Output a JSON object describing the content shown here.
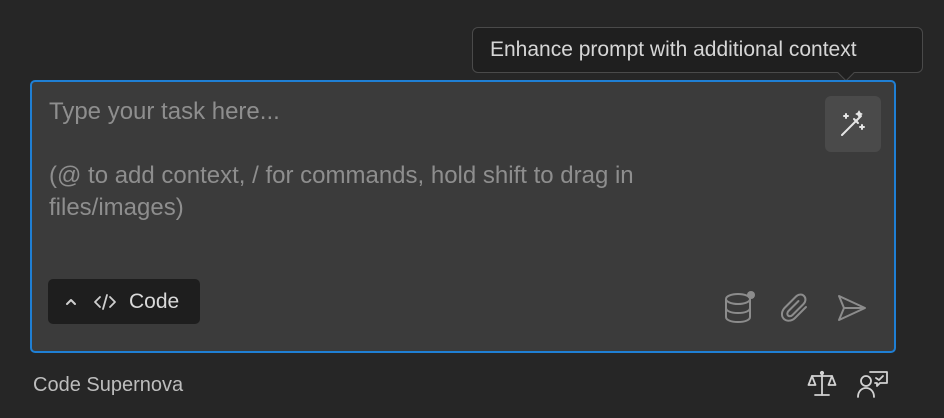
{
  "tooltip": {
    "text": "Enhance prompt with additional context"
  },
  "input": {
    "placeholder_line1": "Type your task here...",
    "placeholder_line2": "(@ to add context, / for commands, hold shift to drag in files/images)"
  },
  "mode": {
    "label": "Code",
    "chevron_icon": "chevron-up-icon",
    "mode_icon": "code-icon"
  },
  "toolbar": {
    "enhance_icon": "magic-wand-icon",
    "database_icon": "database-icon",
    "attach_icon": "paperclip-icon",
    "send_icon": "send-icon"
  },
  "footer": {
    "profile_label": "Code Supernova",
    "balance_icon": "scale-icon",
    "feedback_icon": "person-chat-icon"
  },
  "colors": {
    "background": "#262626",
    "input_background": "#3b3b3b",
    "focus_border": "#1f7fd4"
  }
}
